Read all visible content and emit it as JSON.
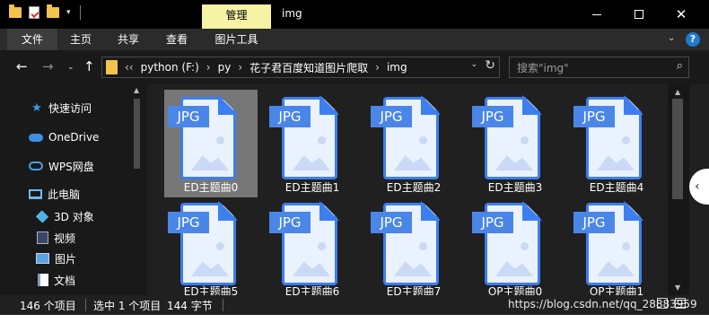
{
  "titlebar": {
    "context_tab": "管理",
    "title": "img"
  },
  "ribbon": {
    "tabs": [
      "文件",
      "主页",
      "共享",
      "查看",
      "图片工具"
    ],
    "help_label": "?"
  },
  "navigation": {
    "path": [
      "python (F:)",
      "py",
      "花子君百度知道图片爬取",
      "img"
    ],
    "search_placeholder": "搜索\"img\""
  },
  "sidebar": {
    "items": [
      {
        "label": "快速访问",
        "icon": "star-icon"
      },
      {
        "label": "OneDrive",
        "icon": "cloud-icon"
      },
      {
        "label": "WPS网盘",
        "icon": "cloud-outline-icon"
      },
      {
        "label": "此电脑",
        "icon": "computer-icon"
      },
      {
        "label": "3D 对象",
        "icon": "cube-icon"
      },
      {
        "label": "视频",
        "icon": "video-icon"
      },
      {
        "label": "图片",
        "icon": "pictures-icon"
      },
      {
        "label": "文档",
        "icon": "document-icon"
      }
    ]
  },
  "files": [
    {
      "name": "ED主题曲0",
      "type": "JPG",
      "selected": true
    },
    {
      "name": "ED主题曲1",
      "type": "JPG",
      "selected": false
    },
    {
      "name": "ED主题曲2",
      "type": "JPG",
      "selected": false
    },
    {
      "name": "ED主题曲3",
      "type": "JPG",
      "selected": false
    },
    {
      "name": "ED主题曲4",
      "type": "JPG",
      "selected": false
    },
    {
      "name": "ED主题曲5",
      "type": "JPG",
      "selected": false
    },
    {
      "name": "ED主题曲6",
      "type": "JPG",
      "selected": false
    },
    {
      "name": "ED主题曲7",
      "type": "JPG",
      "selected": false
    },
    {
      "name": "OP主题曲0",
      "type": "JPG",
      "selected": false
    },
    {
      "name": "OP主题曲1",
      "type": "JPG",
      "selected": false
    }
  ],
  "status": {
    "item_count": "146 个项目",
    "selection": "选中 1 个项目",
    "size": "144 字节"
  },
  "watermark": "https://blog.csdn.net/qq_28883959",
  "colors": {
    "accent": "#3d7ef0",
    "folder": "#f3c44b",
    "context_tab": "#f7f3a5",
    "selected_tile": "#777777"
  }
}
